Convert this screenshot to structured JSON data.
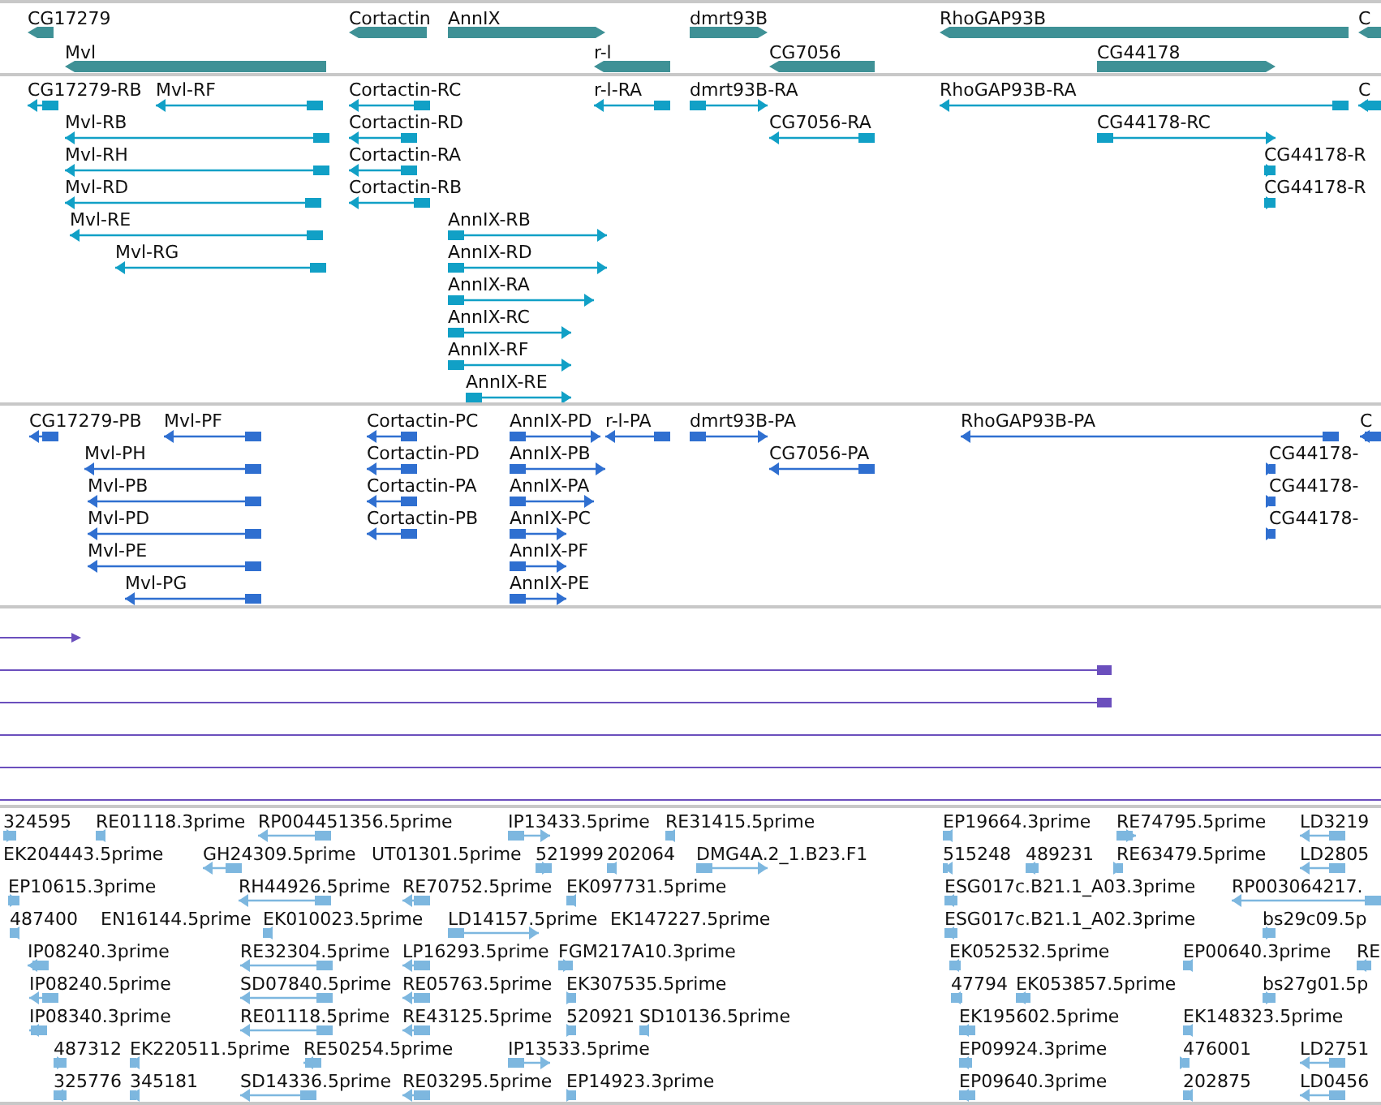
{
  "gene_track": [
    {
      "label": "CG17279",
      "reverse": true
    },
    {
      "label": "Mvl",
      "reverse": true
    },
    {
      "label": "Cortactin",
      "reverse": true
    },
    {
      "label": "AnnIX",
      "reverse": false
    },
    {
      "label": "r-l",
      "reverse": true
    },
    {
      "label": "dmrt93B",
      "reverse": false
    },
    {
      "label": "CG7056",
      "reverse": true
    },
    {
      "label": "RhoGAP93B",
      "reverse": true
    },
    {
      "label": "CG44178",
      "reverse": false
    },
    {
      "label": "C",
      "reverse": true
    }
  ],
  "transcript_track": [
    {
      "label": "CG17279-RB",
      "reverse": true
    },
    {
      "label": "Mvl-RF",
      "reverse": true
    },
    {
      "label": "Cortactin-RC",
      "reverse": true
    },
    {
      "label": "r-l-RA",
      "reverse": true
    },
    {
      "label": "dmrt93B-RA",
      "reverse": false
    },
    {
      "label": "RhoGAP93B-RA",
      "reverse": true
    },
    {
      "label": "C",
      "reverse": true
    },
    {
      "label": "Mvl-RB",
      "reverse": true
    },
    {
      "label": "Cortactin-RD",
      "reverse": true
    },
    {
      "label": "CG7056-RA",
      "reverse": true
    },
    {
      "label": "CG44178-RC",
      "reverse": false
    },
    {
      "label": "Mvl-RH",
      "reverse": true
    },
    {
      "label": "Cortactin-RA",
      "reverse": true
    },
    {
      "label": "CG44178-R",
      "reverse": false
    },
    {
      "label": "Mvl-RD",
      "reverse": true
    },
    {
      "label": "Cortactin-RB",
      "reverse": true
    },
    {
      "label": "CG44178-R",
      "reverse": false
    },
    {
      "label": "Mvl-RE",
      "reverse": true
    },
    {
      "label": "AnnIX-RB",
      "reverse": false
    },
    {
      "label": "Mvl-RG",
      "reverse": true
    },
    {
      "label": "AnnIX-RD",
      "reverse": false
    },
    {
      "label": "AnnIX-RA",
      "reverse": false
    },
    {
      "label": "AnnIX-RC",
      "reverse": false
    },
    {
      "label": "AnnIX-RF",
      "reverse": false
    },
    {
      "label": "AnnIX-RE",
      "reverse": false
    }
  ],
  "protein_track": [
    {
      "label": "CG17279-PB",
      "reverse": true
    },
    {
      "label": "Mvl-PF",
      "reverse": true
    },
    {
      "label": "Cortactin-PC",
      "reverse": true
    },
    {
      "label": "AnnIX-PD",
      "reverse": false
    },
    {
      "label": "r-l-PA",
      "reverse": true
    },
    {
      "label": "dmrt93B-PA",
      "reverse": false
    },
    {
      "label": "RhoGAP93B-PA",
      "reverse": true
    },
    {
      "label": "C",
      "reverse": true
    },
    {
      "label": "Mvl-PH",
      "reverse": true
    },
    {
      "label": "Cortactin-PD",
      "reverse": true
    },
    {
      "label": "AnnIX-PB",
      "reverse": false
    },
    {
      "label": "CG7056-PA",
      "reverse": true
    },
    {
      "label": "CG44178-",
      "reverse": false
    },
    {
      "label": "Mvl-PB",
      "reverse": true
    },
    {
      "label": "Cortactin-PA",
      "reverse": true
    },
    {
      "label": "AnnIX-PA",
      "reverse": false
    },
    {
      "label": "CG44178-",
      "reverse": false
    },
    {
      "label": "Mvl-PD",
      "reverse": true
    },
    {
      "label": "Cortactin-PB",
      "reverse": true
    },
    {
      "label": "AnnIX-PC",
      "reverse": false
    },
    {
      "label": "CG44178-",
      "reverse": false
    },
    {
      "label": "Mvl-PE",
      "reverse": true
    },
    {
      "label": "AnnIX-PF",
      "reverse": false
    },
    {
      "label": "Mvl-PG",
      "reverse": true
    },
    {
      "label": "AnnIX-PE",
      "reverse": false
    }
  ],
  "est_track": [
    {
      "label": "324595",
      "reverse": false
    },
    {
      "label": "RE01118.3prime",
      "reverse": true
    },
    {
      "label": "RP004451356.5prime",
      "reverse": true
    },
    {
      "label": "IP13433.5prime",
      "reverse": false
    },
    {
      "label": "RE31415.5prime",
      "reverse": true
    },
    {
      "label": "EP19664.3prime",
      "reverse": true
    },
    {
      "label": "RE74795.5prime",
      "reverse": false
    },
    {
      "label": "LD3219",
      "reverse": true
    },
    {
      "label": "EK204443.5prime"
    },
    {
      "label": "GH24309.5prime",
      "reverse": true
    },
    {
      "label": "UT01301.5prime"
    },
    {
      "label": "521999",
      "reverse": false
    },
    {
      "label": "202064",
      "reverse": true
    },
    {
      "label": "DMG4A.2_1.B23.F1",
      "reverse": false
    },
    {
      "label": "515248",
      "reverse": true
    },
    {
      "label": "489231",
      "reverse": true
    },
    {
      "label": "RE63479.5prime",
      "reverse": false
    },
    {
      "label": "LD2805",
      "reverse": true
    },
    {
      "label": "EP10615.3prime",
      "reverse": false
    },
    {
      "label": "RH44926.5prime",
      "reverse": true
    },
    {
      "label": "RE70752.5prime",
      "reverse": true
    },
    {
      "label": "EK097731.5prime",
      "reverse": true
    },
    {
      "label": "ESG017c.B21.1_A03.3prime",
      "reverse": true
    },
    {
      "label": "RP003064217.",
      "reverse": true
    },
    {
      "label": "487400",
      "reverse": true
    },
    {
      "label": "EN16144.5prime"
    },
    {
      "label": "EK010023.5prime",
      "reverse": true
    },
    {
      "label": "LD14157.5prime",
      "reverse": false
    },
    {
      "label": "EK147227.5prime"
    },
    {
      "label": "ESG017c.B21.1_A02.3prime",
      "reverse": true
    },
    {
      "label": "bs29c09.5p",
      "reverse": false
    },
    {
      "label": "IP08240.3prime",
      "reverse": true
    },
    {
      "label": "RE32304.5prime",
      "reverse": true
    },
    {
      "label": "LP16293.5prime",
      "reverse": true
    },
    {
      "label": "FGM217A10.3prime",
      "reverse": false
    },
    {
      "label": "EK052532.5prime",
      "reverse": true
    },
    {
      "label": "EP00640.3prime",
      "reverse": true
    },
    {
      "label": "RE",
      "reverse": true
    },
    {
      "label": "IP08240.5prime",
      "reverse": true
    },
    {
      "label": "SD07840.5prime",
      "reverse": true
    },
    {
      "label": "RE05763.5prime",
      "reverse": true
    },
    {
      "label": "EK307535.5prime",
      "reverse": false
    },
    {
      "label": "47794",
      "reverse": true
    },
    {
      "label": "EK053857.5prime",
      "reverse": true
    },
    {
      "label": "bs27g01.5p",
      "reverse": false
    },
    {
      "label": "IP08340.3prime",
      "reverse": true
    },
    {
      "label": "RE01118.5prime",
      "reverse": true
    },
    {
      "label": "RE43125.5prime",
      "reverse": true
    },
    {
      "label": "520921",
      "reverse": false
    },
    {
      "label": "SD10136.5prime",
      "reverse": true
    },
    {
      "label": "EK195602.5prime",
      "reverse": true
    },
    {
      "label": "EK148323.5prime",
      "reverse": true
    },
    {
      "label": "487312",
      "reverse": false
    },
    {
      "label": "EK220511.5prime",
      "reverse": true
    },
    {
      "label": "RE50254.5prime",
      "reverse": true
    },
    {
      "label": "IP13533.5prime",
      "reverse": false
    },
    {
      "label": "EP09924.3prime",
      "reverse": true
    },
    {
      "label": "476001",
      "reverse": false
    },
    {
      "label": "LD2751",
      "reverse": true
    },
    {
      "label": "325776",
      "reverse": true
    },
    {
      "label": "345181",
      "reverse": true
    },
    {
      "label": "SD14336.5prime",
      "reverse": true
    },
    {
      "label": "RE03295.5prime",
      "reverse": true
    },
    {
      "label": "EP14923.3prime",
      "reverse": false
    },
    {
      "label": "EP09640.3prime",
      "reverse": true
    },
    {
      "label": "202875",
      "reverse": true
    },
    {
      "label": "LD0456",
      "reverse": true
    }
  ]
}
